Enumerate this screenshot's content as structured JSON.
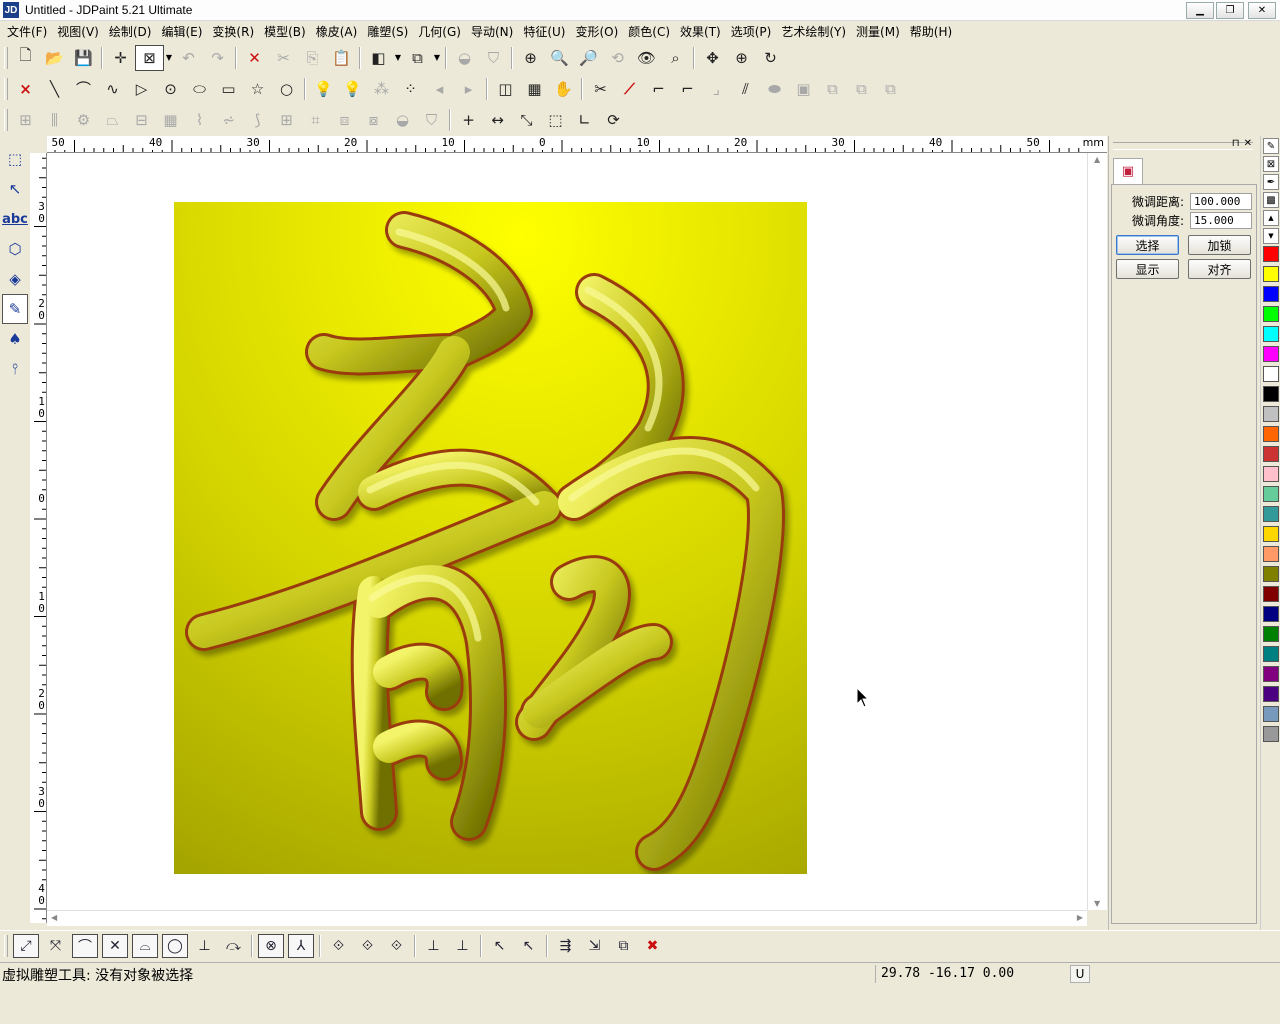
{
  "window": {
    "title": "Untitled - JDPaint 5.21 Ultimate",
    "icon_label": "JD",
    "controls": {
      "minimize": "▁",
      "maximize": "❐",
      "close": "✕"
    }
  },
  "menu": [
    "文件(F)",
    "视图(V)",
    "绘制(D)",
    "编辑(E)",
    "变换(R)",
    "模型(B)",
    "橡皮(A)",
    "雕塑(S)",
    "几何(G)",
    "导动(N)",
    "特征(U)",
    "变形(O)",
    "颜色(C)",
    "效果(T)",
    "选项(P)",
    "艺术绘制(Y)",
    "测量(M)",
    "帮助(H)"
  ],
  "toolbar1": [
    {
      "name": "new-file-icon",
      "glyph": "🗋"
    },
    {
      "name": "open-file-icon",
      "glyph": "📂"
    },
    {
      "name": "save-icon",
      "glyph": "💾"
    },
    {
      "sep": true
    },
    {
      "name": "crosshair-icon",
      "glyph": "✛"
    },
    {
      "name": "select-box-icon",
      "glyph": "⊠",
      "pressed": true
    },
    {
      "dropdown": true
    },
    {
      "name": "undo-icon",
      "glyph": "↶",
      "dim": true
    },
    {
      "name": "redo-icon",
      "glyph": "↷",
      "dim": true
    },
    {
      "sep": true
    },
    {
      "name": "delete-icon",
      "glyph": "✕",
      "red": true
    },
    {
      "name": "cut-icon",
      "glyph": "✂",
      "dim": true
    },
    {
      "name": "copy-icon",
      "glyph": "⎘",
      "dim": true
    },
    {
      "name": "paste-icon",
      "glyph": "📋"
    },
    {
      "sep": true
    },
    {
      "name": "render-mode-icon",
      "glyph": "◧"
    },
    {
      "dropdown": true
    },
    {
      "name": "view-cube-icon",
      "glyph": "⧉"
    },
    {
      "dropdown": true
    },
    {
      "sep": true
    },
    {
      "name": "shade-mode-icon",
      "glyph": "◒",
      "dim": true
    },
    {
      "name": "shield-shade-icon",
      "glyph": "⛉",
      "dim": true
    },
    {
      "sep": true
    },
    {
      "name": "zoom-window-icon",
      "glyph": "⊕"
    },
    {
      "name": "zoom-prev-icon",
      "glyph": "🔍"
    },
    {
      "name": "zoom-next-icon",
      "glyph": "🔎"
    },
    {
      "name": "zoom-refresh-icon",
      "glyph": "⟲",
      "dim": true
    },
    {
      "name": "eye-view-icon",
      "glyph": "👁"
    },
    {
      "name": "zoom-fit-icon",
      "glyph": "⌕"
    },
    {
      "sep": true
    },
    {
      "name": "pan-icon",
      "glyph": "✥"
    },
    {
      "name": "zoom-icon",
      "glyph": "⊕"
    },
    {
      "name": "redraw-icon",
      "glyph": "↻"
    }
  ],
  "toolbar2": [
    {
      "name": "point-icon",
      "glyph": "×",
      "red": true
    },
    {
      "name": "line-icon",
      "glyph": "╲"
    },
    {
      "name": "arc-icon",
      "glyph": "⌒"
    },
    {
      "name": "curve-icon",
      "glyph": "∿"
    },
    {
      "name": "polyline-icon",
      "glyph": "▷"
    },
    {
      "name": "circle-center-icon",
      "glyph": "⊙"
    },
    {
      "name": "ellipse-icon",
      "glyph": "⬭"
    },
    {
      "name": "rectangle-icon",
      "glyph": "▭"
    },
    {
      "name": "star-icon",
      "glyph": "☆"
    },
    {
      "name": "circle-icon",
      "glyph": "○"
    },
    {
      "sep": true
    },
    {
      "name": "bulb-green-icon",
      "glyph": "💡"
    },
    {
      "name": "bulb-yellow-icon",
      "glyph": "💡"
    },
    {
      "name": "nodes-icon",
      "glyph": "⁂",
      "dim": true
    },
    {
      "name": "node-edit-icon",
      "glyph": "⁘"
    },
    {
      "name": "arrow-left-icon",
      "glyph": "◂",
      "dim": true
    },
    {
      "name": "arrow-right-icon",
      "glyph": "▸",
      "dim": true
    },
    {
      "sep": true
    },
    {
      "name": "mirror-icon",
      "glyph": "◫"
    },
    {
      "name": "array-icon",
      "glyph": "▦"
    },
    {
      "name": "hand-icon",
      "glyph": "✋",
      "dim": true
    },
    {
      "sep": true
    },
    {
      "name": "trim-icon",
      "glyph": "✂"
    },
    {
      "name": "extend-icon",
      "glyph": "⟋",
      "red": true
    },
    {
      "name": "fillet-icon",
      "glyph": "⌐"
    },
    {
      "name": "chamfer-icon",
      "glyph": "⌐"
    },
    {
      "name": "corner-icon",
      "glyph": "⌟",
      "dim": true
    },
    {
      "name": "offset-icon",
      "glyph": "⫽"
    },
    {
      "name": "slot-icon",
      "glyph": "⬬",
      "dim": true
    },
    {
      "name": "frame-icon",
      "glyph": "▣",
      "dim": true
    },
    {
      "name": "group-icon",
      "glyph": "⧉",
      "dim": true
    },
    {
      "name": "ungroup-icon",
      "glyph": "⧉",
      "dim": true
    },
    {
      "name": "combine-icon",
      "glyph": "⧉",
      "dim": true
    }
  ],
  "toolbar3": [
    {
      "name": "align-icon",
      "glyph": "⊞",
      "dim": true
    },
    {
      "name": "distribute-icon",
      "glyph": "⫼",
      "dim": true
    },
    {
      "name": "gear-shape-icon",
      "glyph": "⚙",
      "dim": true
    },
    {
      "name": "sweep-icon",
      "glyph": "⏢",
      "dim": true
    },
    {
      "name": "loft-icon",
      "glyph": "⊟",
      "dim": true
    },
    {
      "name": "grid-mesh-icon",
      "glyph": "▦",
      "dim": true
    },
    {
      "name": "wave-icon",
      "glyph": "⌇",
      "dim": true
    },
    {
      "name": "twist-icon",
      "glyph": "⩫",
      "dim": true
    },
    {
      "name": "spiral-icon",
      "glyph": "⟆",
      "dim": true
    },
    {
      "name": "box-grid-icon",
      "glyph": "⊞",
      "dim": true
    },
    {
      "name": "lattice-icon",
      "glyph": "⌗",
      "dim": true
    },
    {
      "name": "boolean-icon",
      "glyph": "⧈",
      "dim": true
    },
    {
      "name": "boolean2-icon",
      "glyph": "⧇",
      "dim": true
    },
    {
      "name": "dome-icon",
      "glyph": "◒",
      "dim": true
    },
    {
      "name": "shield-icon",
      "glyph": "⛉",
      "dim": true
    },
    {
      "sep": true
    },
    {
      "name": "point-mark-icon",
      "glyph": "+"
    },
    {
      "name": "dimension-icon",
      "glyph": "↔"
    },
    {
      "name": "rotate-dim-icon",
      "glyph": "⤡"
    },
    {
      "name": "bounding-box-icon",
      "glyph": "⬚"
    },
    {
      "name": "angle-icon",
      "glyph": "∟"
    },
    {
      "name": "refresh-shape-icon",
      "glyph": "⟳"
    }
  ],
  "left_tools": [
    {
      "name": "select-tool-icon",
      "glyph": "⬚"
    },
    {
      "name": "node-tool-icon",
      "glyph": "↖"
    },
    {
      "name": "text-tool-icon",
      "glyph": "abc"
    },
    {
      "name": "shape-tool-icon",
      "glyph": "⬡"
    },
    {
      "name": "fill-tool-icon",
      "glyph": "◈"
    },
    {
      "name": "sculpt-tool-icon",
      "glyph": "✎",
      "active": true
    },
    {
      "name": "toolpath-tool-icon",
      "glyph": "♠"
    },
    {
      "name": "measure-tool-icon",
      "glyph": "⫯"
    }
  ],
  "ruler": {
    "unit": "mm",
    "h_labels": [
      "50",
      "40",
      "30",
      "20",
      "10",
      "0",
      "10",
      "20",
      "30",
      "40",
      "50"
    ],
    "v_labels": [
      "30",
      "20",
      "10",
      "0",
      "10",
      "20",
      "30",
      "40"
    ]
  },
  "panel": {
    "tab_icon": "▣",
    "distance_label": "微调距离:",
    "distance_value": "100.000",
    "angle_label": "微调角度:",
    "angle_value": "15.000",
    "btn_select": "选择",
    "btn_lock": "加锁",
    "btn_show": "显示",
    "btn_align": "对齐",
    "pin": "⊓",
    "close": "✕"
  },
  "palette_tools": [
    "pencil-icon",
    "no-color-icon",
    "eyedropper-icon",
    "pattern-icon"
  ],
  "palette_colors": [
    "#ffff00",
    "#dcdcdc",
    "#000000",
    "#ff0000",
    "#ffff00",
    "#0000ff",
    "#00ff00",
    "#00ffff",
    "#ff00ff",
    "#ffffff",
    "#000000",
    "#c0c0c0",
    "#ff6600",
    "#cc3333",
    "#ffc0cb",
    "#66cc99",
    "#339999",
    "#ffd700",
    "#ff9966",
    "#808000",
    "#800000",
    "#000080",
    "#008000",
    "#008080",
    "#800080",
    "#4b0082",
    "#7799bb",
    "#999999"
  ],
  "bottom_tools": [
    {
      "name": "snap-endpoint-icon",
      "glyph": "⤢",
      "boxed": true
    },
    {
      "name": "snap-midpoint-icon",
      "glyph": "⤧"
    },
    {
      "name": "snap-arc-icon",
      "glyph": "⌒",
      "boxed": true
    },
    {
      "name": "snap-intersect-icon",
      "glyph": "✕",
      "boxed": true
    },
    {
      "name": "snap-tangent-icon",
      "glyph": "⌓",
      "boxed": true
    },
    {
      "name": "snap-center-icon",
      "glyph": "◯",
      "boxed": true
    },
    {
      "name": "snap-perp-icon",
      "glyph": "⊥"
    },
    {
      "name": "snap-nearest-icon",
      "glyph": "⤼"
    },
    {
      "sep": true
    },
    {
      "name": "snap-point-icon",
      "glyph": "⊗",
      "boxed": true
    },
    {
      "name": "snap-axis-icon",
      "glyph": "⅄",
      "boxed": true
    },
    {
      "sep": true
    },
    {
      "name": "rotate-view-icon",
      "glyph": "⟐"
    },
    {
      "name": "rotate-view2-icon",
      "glyph": "⟐"
    },
    {
      "name": "rotate-view3-icon",
      "glyph": "⟐"
    },
    {
      "sep": true
    },
    {
      "name": "level-icon",
      "glyph": "⊥"
    },
    {
      "name": "level2-icon",
      "glyph": "⊥"
    },
    {
      "sep": true
    },
    {
      "name": "pick-icon",
      "glyph": "↖"
    },
    {
      "name": "unpick-icon",
      "glyph": "↖"
    },
    {
      "sep": true
    },
    {
      "name": "move-nodes-icon",
      "glyph": "⇶"
    },
    {
      "name": "scale-nodes-icon",
      "glyph": "⇲"
    },
    {
      "name": "copy-nodes-icon",
      "glyph": "⧉"
    },
    {
      "name": "cancel-icon",
      "glyph": "✖",
      "red": true
    }
  ],
  "status": {
    "message": "虚拟雕塑工具: 没有对象被选择",
    "coords": "29.78  -16.17  0.00",
    "mode": "U"
  }
}
